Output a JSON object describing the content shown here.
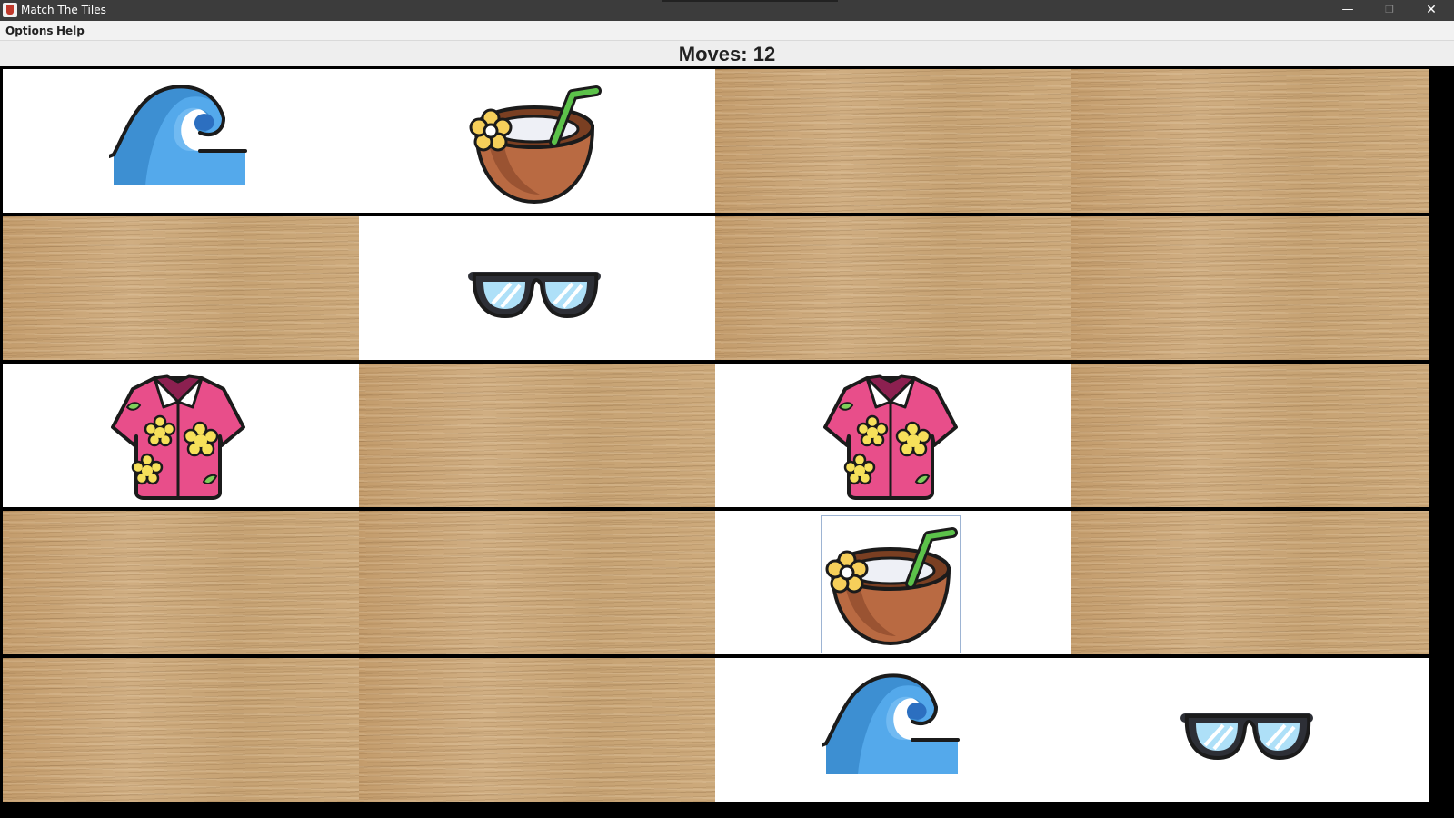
{
  "window": {
    "title": "Match The Tiles",
    "controls": {
      "minimize": "—",
      "maximize": "❐",
      "close": "✕"
    }
  },
  "menu": {
    "items": [
      "Options",
      "Help"
    ]
  },
  "status": {
    "moves_text": "Moves: 12",
    "moves": 12
  },
  "board": {
    "rows": 5,
    "cols": 4,
    "selected_tile": {
      "row": 3,
      "col": 2
    },
    "tiles": [
      [
        {
          "state": "up",
          "icon": "wave-icon"
        },
        {
          "state": "up",
          "icon": "coconut-drink-icon"
        },
        {
          "state": "down"
        },
        {
          "state": "down"
        }
      ],
      [
        {
          "state": "down"
        },
        {
          "state": "up",
          "icon": "sunglasses-icon"
        },
        {
          "state": "down"
        },
        {
          "state": "down"
        }
      ],
      [
        {
          "state": "up",
          "icon": "hawaiian-shirt-icon"
        },
        {
          "state": "down"
        },
        {
          "state": "up",
          "icon": "hawaiian-shirt-icon"
        },
        {
          "state": "down"
        }
      ],
      [
        {
          "state": "down"
        },
        {
          "state": "down"
        },
        {
          "state": "up",
          "icon": "coconut-drink-icon"
        },
        {
          "state": "down"
        }
      ],
      [
        {
          "state": "down"
        },
        {
          "state": "down"
        },
        {
          "state": "up",
          "icon": "wave-icon"
        },
        {
          "state": "up",
          "icon": "sunglasses-icon"
        }
      ]
    ]
  },
  "colors": {
    "face_down_wood": "#c9a67a",
    "face_up": "#ffffff",
    "grid_lines": "#000000",
    "title_bar": "#3c3c3c"
  }
}
